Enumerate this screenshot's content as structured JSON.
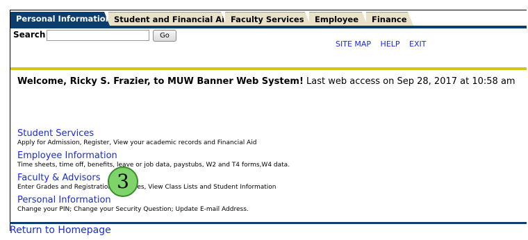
{
  "tabs": [
    {
      "label": "Personal Information",
      "active": true
    },
    {
      "label": "Student and Financial Aid",
      "active": false
    },
    {
      "label": "Faculty Services",
      "active": false
    },
    {
      "label": "Employee",
      "active": false
    },
    {
      "label": "Finance",
      "active": false
    }
  ],
  "search": {
    "label": "Search",
    "value": "",
    "placeholder": "",
    "button": "Go"
  },
  "toplinks": {
    "site_map": "SITE MAP",
    "help": "HELP",
    "exit": "EXIT"
  },
  "welcome": {
    "bold": "Welcome, Ricky S. Frazier, to MUW Banner Web System!",
    "rest": " Last web access on Sep 28, 2017 at 10:58 am"
  },
  "menu": [
    {
      "title": "Student Services",
      "desc": "Apply for Admission, Register, View your academic records and Financial Aid"
    },
    {
      "title": "Employee Information",
      "desc": "Time sheets, time off, benefits, leave or job data, paystubs, W2 and T4 forms,W4 data."
    },
    {
      "title": "Faculty & Advisors",
      "desc": "Enter Grades and Registration Overrides, View Class Lists and Student Information"
    },
    {
      "title": "Personal Information",
      "desc": "Change your PIN; Change your Security Question; Update E-mail Address."
    }
  ],
  "return_link": "Return to Homepage",
  "step_badge": "3",
  "colors": {
    "nav": "#0b3e6f",
    "accent_rule": "#cfc81a",
    "link": "#1a2ae0",
    "badge": "#7ed46a"
  }
}
